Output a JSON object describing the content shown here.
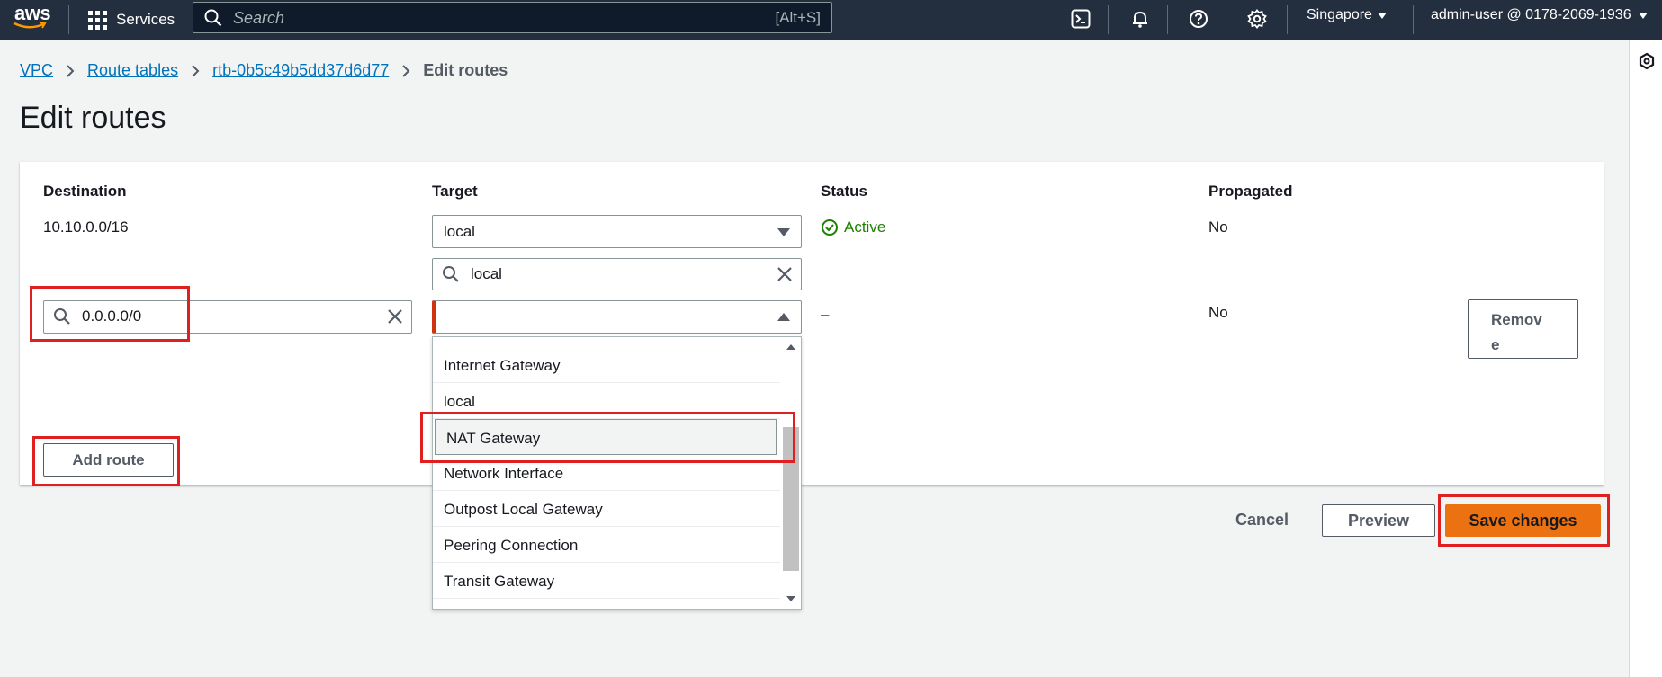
{
  "topnav": {
    "logo_text": "aws",
    "services_label": "Services",
    "search_placeholder": "Search",
    "search_shortcut": "[Alt+S]",
    "region": "Singapore",
    "account": "admin-user @ 0178-2069-1936"
  },
  "breadcrumb": {
    "items": [
      "VPC",
      "Route tables",
      "rtb-0b5c49b5dd37d6d77"
    ],
    "current": "Edit routes"
  },
  "page": {
    "title": "Edit routes"
  },
  "table": {
    "headers": {
      "destination": "Destination",
      "target": "Target",
      "status": "Status",
      "propagated": "Propagated"
    },
    "rows": [
      {
        "destination": "10.10.0.0/16",
        "target": "local",
        "target_filter": "local",
        "status": "Active",
        "propagated": "No"
      },
      {
        "destination": "0.0.0.0/0",
        "target": "",
        "status": "–",
        "propagated": "No",
        "remove_label_1": "Remov",
        "remove_label_2": "e"
      }
    ],
    "add_route_label": "Add route"
  },
  "dropdown": {
    "options": [
      "Internet Gateway",
      "local",
      "NAT Gateway",
      "Network Interface",
      "Outpost Local Gateway",
      "Peering Connection",
      "Transit Gateway"
    ],
    "highlighted": "NAT Gateway"
  },
  "actions": {
    "cancel": "Cancel",
    "preview": "Preview",
    "save": "Save changes"
  },
  "colors": {
    "nav_bg": "#232f3e",
    "primary": "#ec7211",
    "link": "#0073bb",
    "success": "#1d8102",
    "annotation": "#e02020"
  }
}
